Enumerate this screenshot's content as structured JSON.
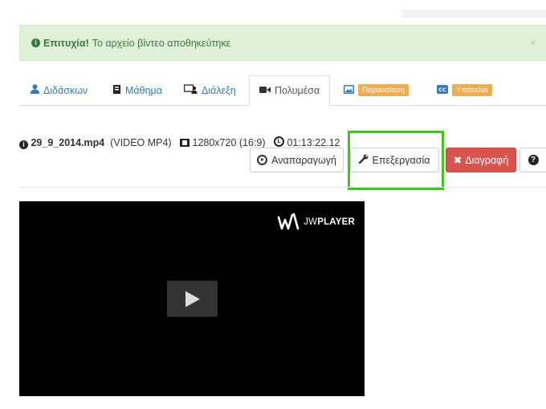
{
  "alert": {
    "title": "Επιτυχία!",
    "message": "Το αρχείο βίντεο αποθηκεύτηκε",
    "close": "×"
  },
  "tabs": [
    {
      "label": "Διδάσκων",
      "icon": "user-icon"
    },
    {
      "label": "Μάθημα",
      "icon": "book-icon"
    },
    {
      "label": "Διάλεξη",
      "icon": "presenter-icon"
    },
    {
      "label": "Πολυμέσα",
      "icon": "video-camera-icon",
      "active": true
    },
    {
      "label": "Παρουσίαση",
      "icon": "picture-icon",
      "badge": true
    },
    {
      "label": "Υπότιτλοι",
      "icon": "cc-icon",
      "badge": true
    }
  ],
  "file": {
    "name": "29_9_2014.mp4",
    "type": "(VIDEO MP4)",
    "resolution": "1280x720 (16:9)",
    "duration": "01:13:22.12"
  },
  "actions": {
    "play": "Αναπαραγωγή",
    "edit": "Επεξεργασία",
    "delete": "Διαγραφή"
  },
  "player": {
    "brand_light": "JW",
    "brand_bold": "PLAYER"
  },
  "colors": {
    "success_bg": "#dff0d8",
    "badge": "#f0ad4e",
    "danger": "#d9534f",
    "highlight": "#3fc71e",
    "link": "#337ab7"
  }
}
